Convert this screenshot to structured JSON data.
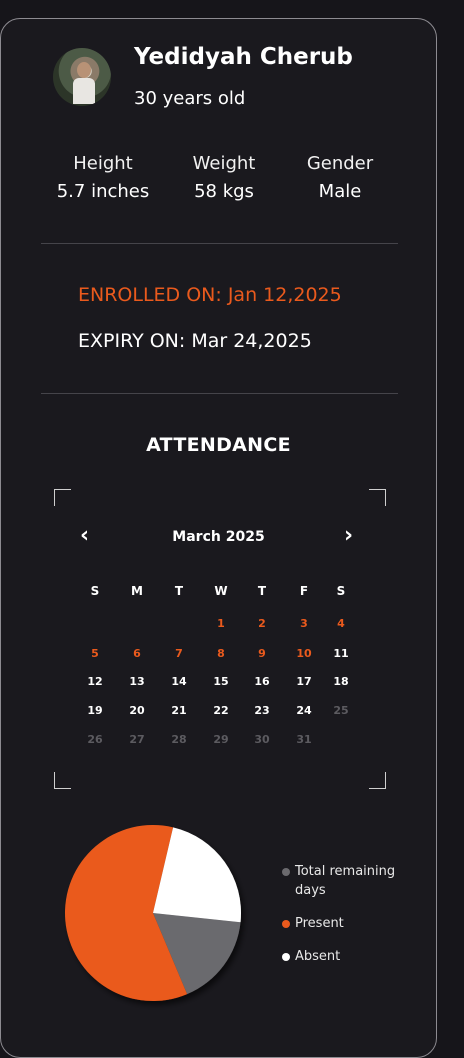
{
  "profile": {
    "name": "Yedidyah Cherub",
    "age": "30 years old",
    "stats": [
      {
        "label": "Height",
        "value": "5.7 inches"
      },
      {
        "label": "Weight",
        "value": "58 kgs"
      },
      {
        "label": "Gender",
        "value": "Male"
      }
    ]
  },
  "membership": {
    "enrolled": "ENROLLED ON: Jan 12,2025",
    "expiry": "EXPIRY ON: Mar 24,2025"
  },
  "attendance": {
    "title": "ATTENDANCE",
    "prev_icon": "‹",
    "next_icon": "›",
    "month": "March 2025",
    "weekdays": [
      "S",
      "M",
      "T",
      "W",
      "T",
      "F",
      "S"
    ],
    "first_weekday_index": 3,
    "days_in_month": 31,
    "present_days": [
      1,
      2,
      3,
      4,
      5,
      6,
      7,
      8,
      9,
      10
    ],
    "future_from": 25
  },
  "colors": {
    "accent": "#ea5a1d",
    "remaining": "#6b6a6e",
    "absent": "#ffffff"
  },
  "chart_data": {
    "type": "pie",
    "labels": [
      "Total remaining days",
      "Present",
      "Absent"
    ],
    "values": [
      17,
      60,
      23
    ],
    "colors": [
      "#6b6a6e",
      "#ea5a1d",
      "#ffffff"
    ]
  }
}
